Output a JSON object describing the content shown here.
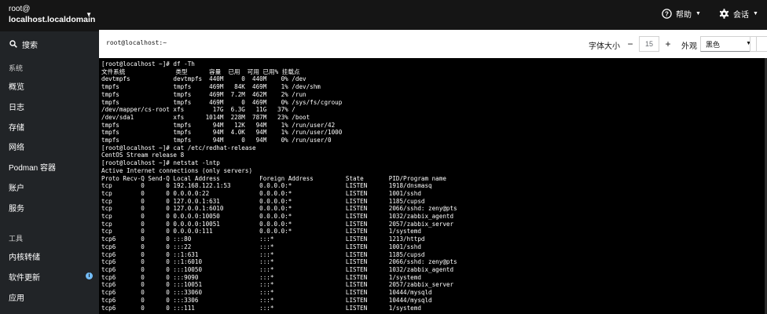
{
  "host": {
    "user": "root@",
    "name": "localhost.localdomain"
  },
  "search": {
    "label": "搜索"
  },
  "nav": {
    "system_label": "系统",
    "system_items": [
      "概览",
      "日志",
      "存储",
      "网络",
      "Podman 容器",
      "账户",
      "服务"
    ],
    "tools_label": "工具",
    "tools_items": [
      "内核转储",
      "软件更新",
      "应用"
    ],
    "update_badge": "i"
  },
  "topbar": {
    "help": "帮助",
    "session": "会话"
  },
  "terminal_header": {
    "title": "root@localhost:~",
    "font_size_label": "字体大小",
    "font_size_value": "15",
    "decrease": "−",
    "increase": "+",
    "appearance_label": "外观",
    "appearance_value": "黑色"
  },
  "terminal": {
    "lines": [
      "[root@localhost ~]# df -Th",
      "文件系统              类型      容量  已用  可用 已用% 挂载点",
      "devtmpfs            devtmpfs  440M     0  440M    0% /dev",
      "tmpfs               tmpfs     469M   84K  469M    1% /dev/shm",
      "tmpfs               tmpfs     469M  7.2M  462M    2% /run",
      "tmpfs               tmpfs     469M     0  469M    0% /sys/fs/cgroup",
      "/dev/mapper/cs-root xfs        17G  6.3G   11G   37% /",
      "/dev/sda1           xfs      1014M  228M  787M   23% /boot",
      "tmpfs               tmpfs      94M   12K   94M    1% /run/user/42",
      "tmpfs               tmpfs      94M  4.0K   94M    1% /run/user/1000",
      "tmpfs               tmpfs      94M     0   94M    0% /run/user/0",
      "[root@localhost ~]# cat /etc/redhat-release",
      "CentOS Stream release 8",
      "[root@localhost ~]# netstat -lntp",
      "Active Internet connections (only servers)",
      "Proto Recv-Q Send-Q Local Address           Foreign Address         State       PID/Program name",
      "tcp        0      0 192.168.122.1:53        0.0.0.0:*               LISTEN      1918/dnsmasq",
      "tcp        0      0 0.0.0.0:22              0.0.0.0:*               LISTEN      1001/sshd",
      "tcp        0      0 127.0.0.1:631           0.0.0.0:*               LISTEN      1185/cupsd",
      "tcp        0      0 127.0.0.1:6010          0.0.0.0:*               LISTEN      2066/sshd: zeny@pts",
      "tcp        0      0 0.0.0.0:10050           0.0.0.0:*               LISTEN      1032/zabbix_agentd",
      "tcp        0      0 0.0.0.0:10051           0.0.0.0:*               LISTEN      2057/zabbix_server",
      "tcp        0      0 0.0.0.0:111             0.0.0.0:*               LISTEN      1/systemd",
      "tcp6       0      0 :::80                   :::*                    LISTEN      1213/httpd",
      "tcp6       0      0 :::22                   :::*                    LISTEN      1001/sshd",
      "tcp6       0      0 ::1:631                 :::*                    LISTEN      1185/cupsd",
      "tcp6       0      0 ::1:6010                :::*                    LISTEN      2066/sshd: zeny@pts",
      "tcp6       0      0 :::10050                :::*                    LISTEN      1032/zabbix_agentd",
      "tcp6       0      0 :::9090                 :::*                    LISTEN      1/systemd",
      "tcp6       0      0 :::10051                :::*                    LISTEN      2057/zabbix_server",
      "tcp6       0      0 :::33060                :::*                    LISTEN      10444/mysqld",
      "tcp6       0      0 :::3306                 :::*                    LISTEN      10444/mysqld",
      "tcp6       0      0 :::111                  :::*                    LISTEN      1/systemd"
    ]
  },
  "colors": {
    "sidebar_bg": "#212427",
    "topbar_bg": "#151515",
    "badge": "#73bcf7"
  }
}
